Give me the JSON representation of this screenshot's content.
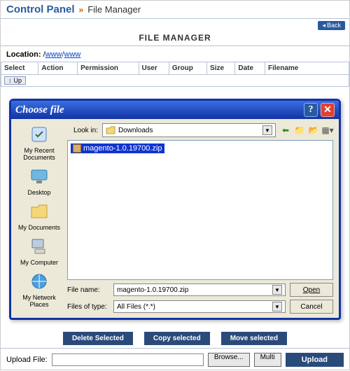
{
  "topbar": {
    "title1": "Control Panel",
    "sep": "»",
    "title2": "File Manager"
  },
  "backrow": {
    "back_label": "Back"
  },
  "fm": {
    "heading": "FILE MANAGER"
  },
  "location": {
    "label": "Location:",
    "parts": [
      "www",
      "www"
    ],
    "sep": "/"
  },
  "columns": [
    "Select",
    "Action",
    "Permission",
    "User",
    "Group",
    "Size",
    "Date",
    "Filename"
  ],
  "up_label": "Up",
  "dialog": {
    "title": "Choose file",
    "look_label": "Look in:",
    "look_value": "Downloads",
    "sidebar": [
      {
        "icon": "recent",
        "label": "My Recent Documents"
      },
      {
        "icon": "desktop",
        "label": "Desktop"
      },
      {
        "icon": "mydocs",
        "label": "My Documents"
      },
      {
        "icon": "mycomp",
        "label": "My Computer"
      },
      {
        "icon": "network",
        "label": "My Network Places"
      }
    ],
    "file_selected": "magento-1.0.19700.zip",
    "filename_label": "File name:",
    "filename_value": "magento-1.0.19700.zip",
    "filter_label": "Files of type:",
    "filter_value": "All Files (*.*)",
    "open_label": "Open",
    "cancel_label": "Cancel"
  },
  "footer": {
    "delete": "Delete Selected",
    "copy": "Copy selected",
    "move": "Move selected",
    "upload_label": "Upload File:",
    "browse": "Browse...",
    "multi": "Multi",
    "upload": "Upload"
  }
}
